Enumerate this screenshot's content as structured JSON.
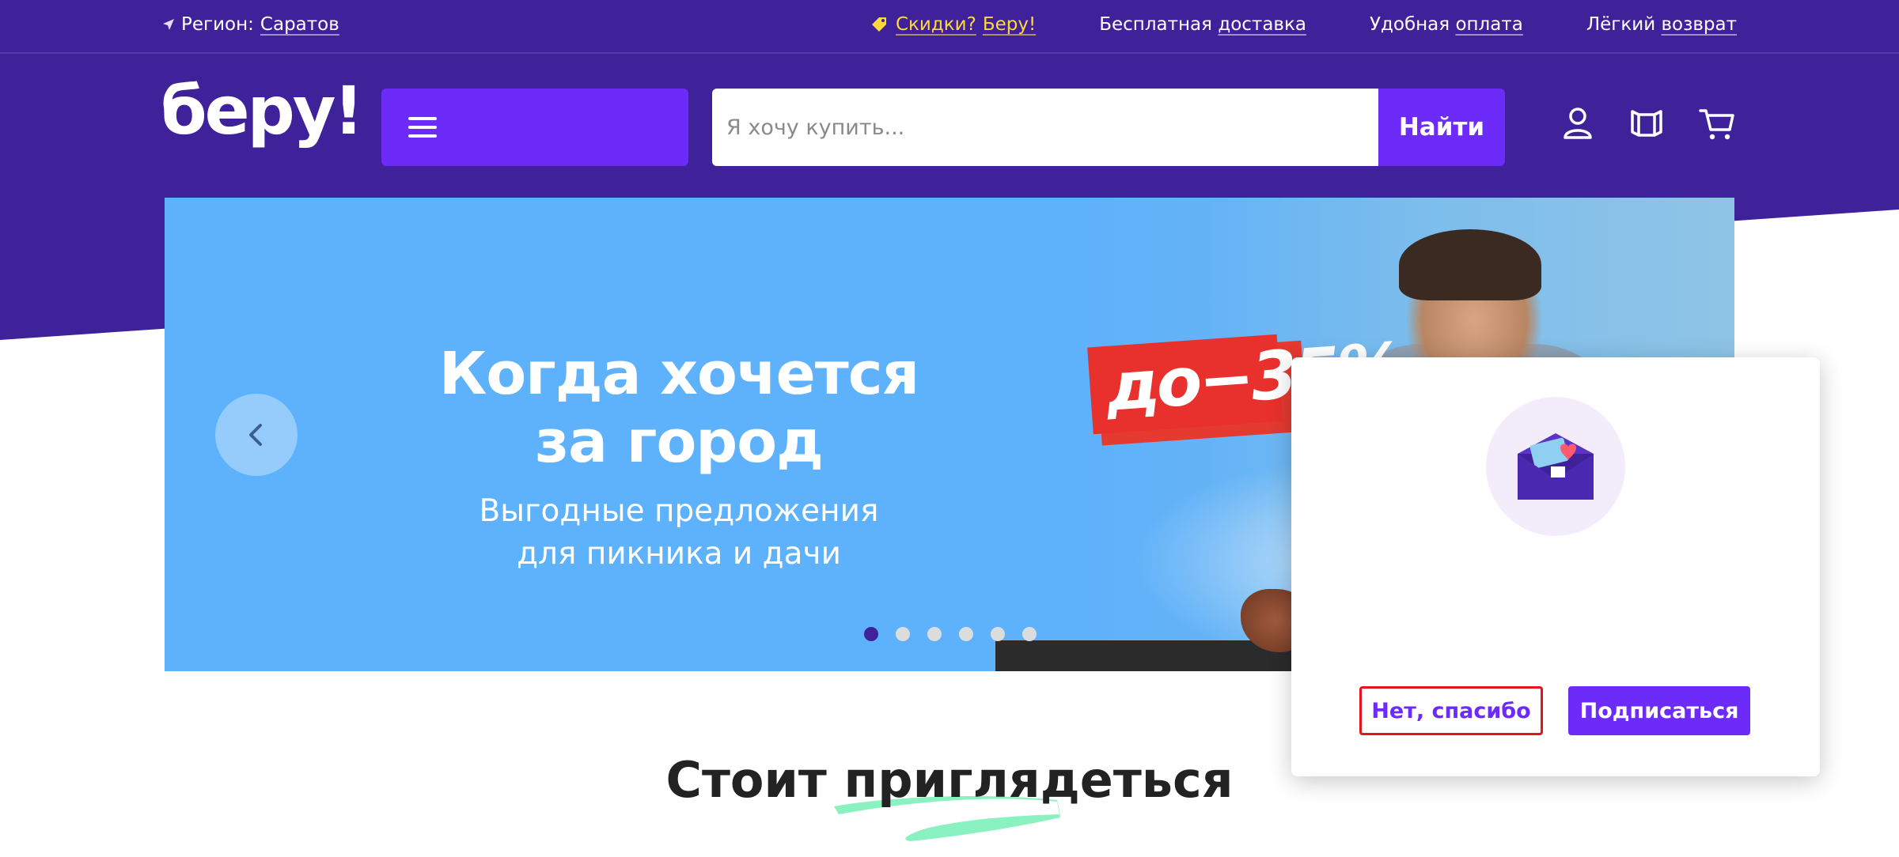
{
  "topbar": {
    "region_label": "Регион:",
    "region_value": "Саратов",
    "links": {
      "promo_a": "Скидки?",
      "promo_b": "Беру!",
      "delivery_a": "Бесплатная",
      "delivery_b": "доставка",
      "payment_a": "Удобная",
      "payment_b": "оплата",
      "return_a": "Лёгкий",
      "return_b": "возврат"
    }
  },
  "header": {
    "logo": "беру!",
    "search": {
      "placeholder": "Я хочу купить...",
      "button": "Найти"
    },
    "icons": [
      "user-icon",
      "compare-icon",
      "cart-icon"
    ]
  },
  "banner": {
    "title_line1": "Когда хочется",
    "title_line2": "за город",
    "subtitle_line1": "Выгодные предложения",
    "subtitle_line2": "для пикника и дачи",
    "discount": "до−35%",
    "active_slide": 1,
    "slide_count": 6
  },
  "section": {
    "title": "Стоит приглядеться"
  },
  "popup": {
    "decline_button": "Нет, спасибо",
    "subscribe_button": "Подписаться"
  },
  "colors": {
    "brand_purple": "#3f219a",
    "accent_purple": "#6c2bf9",
    "banner_blue": "#5eb1fb",
    "promo_yellow": "#ffd83a",
    "discount_red": "#e8312c"
  }
}
